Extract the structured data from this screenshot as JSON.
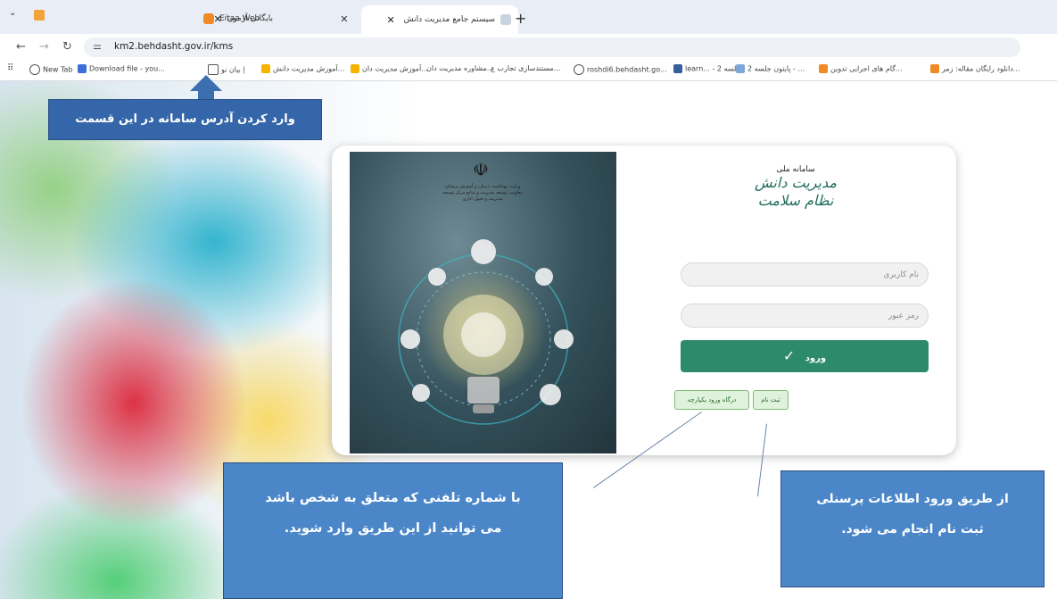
{
  "browser": {
    "tabs": [
      {
        "label": "بایگانی آزمون",
        "active": false
      },
      {
        "label": "Eitaa Web",
        "active": false
      },
      {
        "label": "سیستم جامع مدیریت دانش",
        "active": true
      }
    ],
    "url": "km2.behdasht.gov.ir/kms",
    "bookmarks": [
      "New Tab",
      "Download file - you...",
      "بیان نو |",
      "آموزش مدیریت دانش...",
      "آموزش مدیریت دان...",
      "مشاوره مدیریت دان...",
      "مستندسازی تجارب ع...",
      "roshdi6.behdasht.go...",
      "learn... - 2 جلسه",
      "پایتون جلسه 2 - ...",
      "گام های اجرایی تدوین...",
      "دانلود رایگان مقاله: زمر..."
    ]
  },
  "login": {
    "emblem_text": "وزارت بهداشت، درمان و آموزش پزشکی معاونت توسعه مدیریت و منابع مرکز توسعه مدیریت و تحول اداری",
    "logo_small": "سامانه ملی",
    "logo_line1": "مدیریت دانش",
    "logo_line2": "نظام سلامت",
    "username_placeholder": "نام کاربری",
    "password_placeholder": "رمز عبور",
    "login_button": "ورود",
    "register_button": "ثبت نام",
    "sso_button": "درگاه ورود یکپارچه"
  },
  "annotations": {
    "address_callout": "وارد کردن آدرس سامانه در این قسمت",
    "phone_callout_line1": "با شماره تلفنی که متعلق به شخص باشد",
    "phone_callout_line2": "می توانید از این طریق وارد شوید.",
    "register_callout_line1": "از طریق ورود اطلاعات پرسنلی",
    "register_callout_line2": "ثبت نام انجام می شود."
  },
  "colors": {
    "callout_blue": "#3566a9",
    "login_green": "#2d8b6b",
    "small_button_green": "#dff2dc"
  }
}
